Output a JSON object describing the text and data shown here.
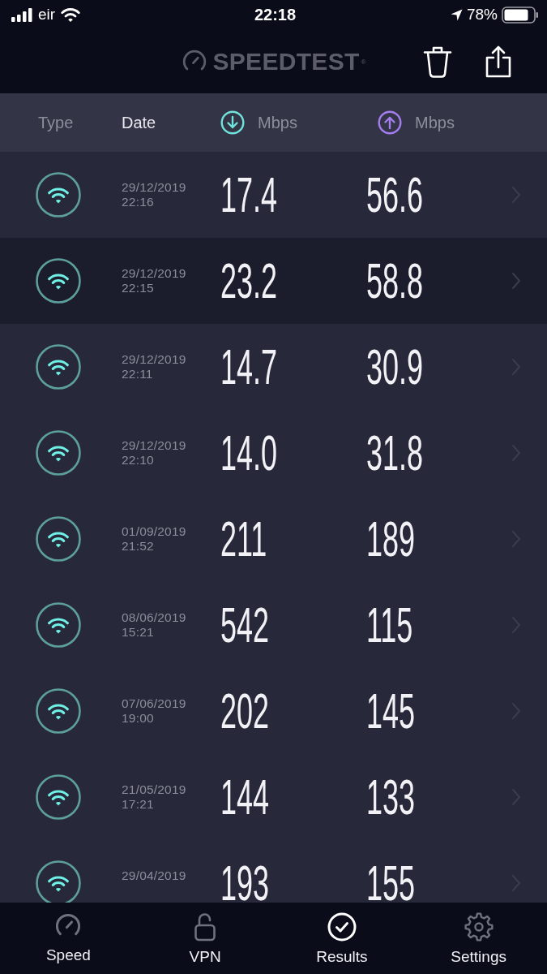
{
  "status_bar": {
    "carrier": "eir",
    "time": "22:18",
    "battery_percent": "78%"
  },
  "header": {
    "logo": "SPEEDTEST",
    "logo_mark": "®"
  },
  "columns": [
    {
      "kind": "text",
      "label": "Type",
      "selected": false
    },
    {
      "kind": "text",
      "label": "Date",
      "selected": true
    },
    {
      "kind": "download",
      "label": "Mbps",
      "selected": false
    },
    {
      "kind": "upload",
      "label": "Mbps",
      "selected": false
    }
  ],
  "results": [
    {
      "kind": "wifi",
      "date": "29/12/2019",
      "time": "22:16",
      "download": "17.4",
      "upload": "56.6",
      "selected": false
    },
    {
      "kind": "wifi",
      "date": "29/12/2019",
      "time": "22:15",
      "download": "23.2",
      "upload": "58.8",
      "selected": true
    },
    {
      "kind": "wifi",
      "date": "29/12/2019",
      "time": "22:11",
      "download": "14.7",
      "upload": "30.9",
      "selected": false
    },
    {
      "kind": "wifi",
      "date": "29/12/2019",
      "time": "22:10",
      "download": "14.0",
      "upload": "31.8",
      "selected": false
    },
    {
      "kind": "wifi",
      "date": "01/09/2019",
      "time": "21:52",
      "download": "211",
      "upload": "189",
      "selected": false
    },
    {
      "kind": "wifi",
      "date": "08/06/2019",
      "time": "15:21",
      "download": "542",
      "upload": "115",
      "selected": false
    },
    {
      "kind": "wifi",
      "date": "07/06/2019",
      "time": "19:00",
      "download": "202",
      "upload": "145",
      "selected": false
    },
    {
      "kind": "wifi",
      "date": "21/05/2019",
      "time": "17:21",
      "download": "144",
      "upload": "133",
      "selected": false
    },
    {
      "kind": "wifi",
      "date": "29/04/2019",
      "download": "193",
      "upload": "155",
      "selected": false
    }
  ],
  "tabs": [
    {
      "kind": "speed",
      "label": "Speed",
      "selected": false
    },
    {
      "kind": "vpn",
      "label": "VPN",
      "selected": false
    },
    {
      "kind": "results",
      "label": "Results",
      "selected": true
    },
    {
      "kind": "settings",
      "label": "Settings",
      "selected": false
    }
  ]
}
